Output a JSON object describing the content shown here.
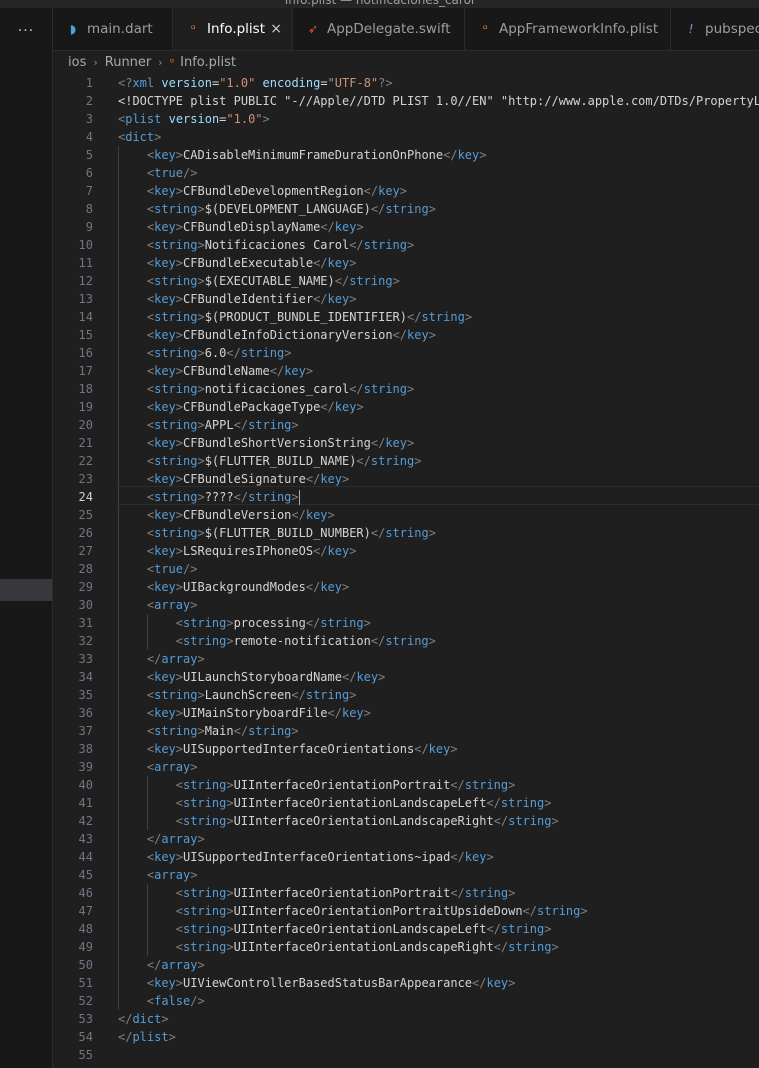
{
  "window": {
    "title": "Info.plist — notificaciones_carol"
  },
  "sidebar": {
    "more_icon": "ellipsis-icon",
    "more_label": "···"
  },
  "tabs": [
    {
      "label": "main.dart",
      "icon": "dart-icon",
      "active": false
    },
    {
      "label": "Info.plist",
      "icon": "rss-icon",
      "active": true,
      "close": "×"
    },
    {
      "label": "AppDelegate.swift",
      "icon": "swift-icon",
      "active": false
    },
    {
      "label": "AppFrameworkInfo.plist",
      "icon": "rss-icon",
      "active": false
    },
    {
      "label": "pubspec.y",
      "icon": "exclamation-icon",
      "active": false
    }
  ],
  "breadcrumb": [
    "ios",
    "Runner",
    "Info.plist"
  ],
  "editor": {
    "current_line": 24,
    "colors": {
      "tag": "#569cd6",
      "attr": "#9cdcfe",
      "value": "#ce9178",
      "text": "#d4d4d4",
      "punct": "#808080"
    },
    "lines": [
      "<?xml version=\"1.0\" encoding=\"UTF-8\"?>",
      "<!DOCTYPE plist PUBLIC \"-//Apple//DTD PLIST 1.0//EN\" \"http://www.apple.com/DTDs/PropertyL",
      "<plist version=\"1.0\">",
      "<dict>",
      "\t<key>CADisableMinimumFrameDurationOnPhone</key>",
      "\t<true/>",
      "\t<key>CFBundleDevelopmentRegion</key>",
      "\t<string>$(DEVELOPMENT_LANGUAGE)</string>",
      "\t<key>CFBundleDisplayName</key>",
      "\t<string>Notificaciones Carol</string>",
      "\t<key>CFBundleExecutable</key>",
      "\t<string>$(EXECUTABLE_NAME)</string>",
      "\t<key>CFBundleIdentifier</key>",
      "\t<string>$(PRODUCT_BUNDLE_IDENTIFIER)</string>",
      "\t<key>CFBundleInfoDictionaryVersion</key>",
      "\t<string>6.0</string>",
      "\t<key>CFBundleName</key>",
      "\t<string>notificaciones_carol</string>",
      "\t<key>CFBundlePackageType</key>",
      "\t<string>APPL</string>",
      "\t<key>CFBundleShortVersionString</key>",
      "\t<string>$(FLUTTER_BUILD_NAME)</string>",
      "\t<key>CFBundleSignature</key>",
      "\t<string>????</string>",
      "\t<key>CFBundleVersion</key>",
      "\t<string>$(FLUTTER_BUILD_NUMBER)</string>",
      "\t<key>LSRequiresIPhoneOS</key>",
      "\t<true/>",
      "\t<key>UIBackgroundModes</key>",
      "\t<array>",
      "\t\t<string>processing</string>",
      "\t\t<string>remote-notification</string>",
      "\t</array>",
      "\t<key>UILaunchStoryboardName</key>",
      "\t<string>LaunchScreen</string>",
      "\t<key>UIMainStoryboardFile</key>",
      "\t<string>Main</string>",
      "\t<key>UISupportedInterfaceOrientations</key>",
      "\t<array>",
      "\t\t<string>UIInterfaceOrientationPortrait</string>",
      "\t\t<string>UIInterfaceOrientationLandscapeLeft</string>",
      "\t\t<string>UIInterfaceOrientationLandscapeRight</string>",
      "\t</array>",
      "\t<key>UISupportedInterfaceOrientations~ipad</key>",
      "\t<array>",
      "\t\t<string>UIInterfaceOrientationPortrait</string>",
      "\t\t<string>UIInterfaceOrientationPortraitUpsideDown</string>",
      "\t\t<string>UIInterfaceOrientationLandscapeLeft</string>",
      "\t\t<string>UIInterfaceOrientationLandscapeRight</string>",
      "\t</array>",
      "\t<key>UIViewControllerBasedStatusBarAppearance</key>",
      "\t<false/>",
      "</dict>",
      "</plist>",
      ""
    ]
  }
}
